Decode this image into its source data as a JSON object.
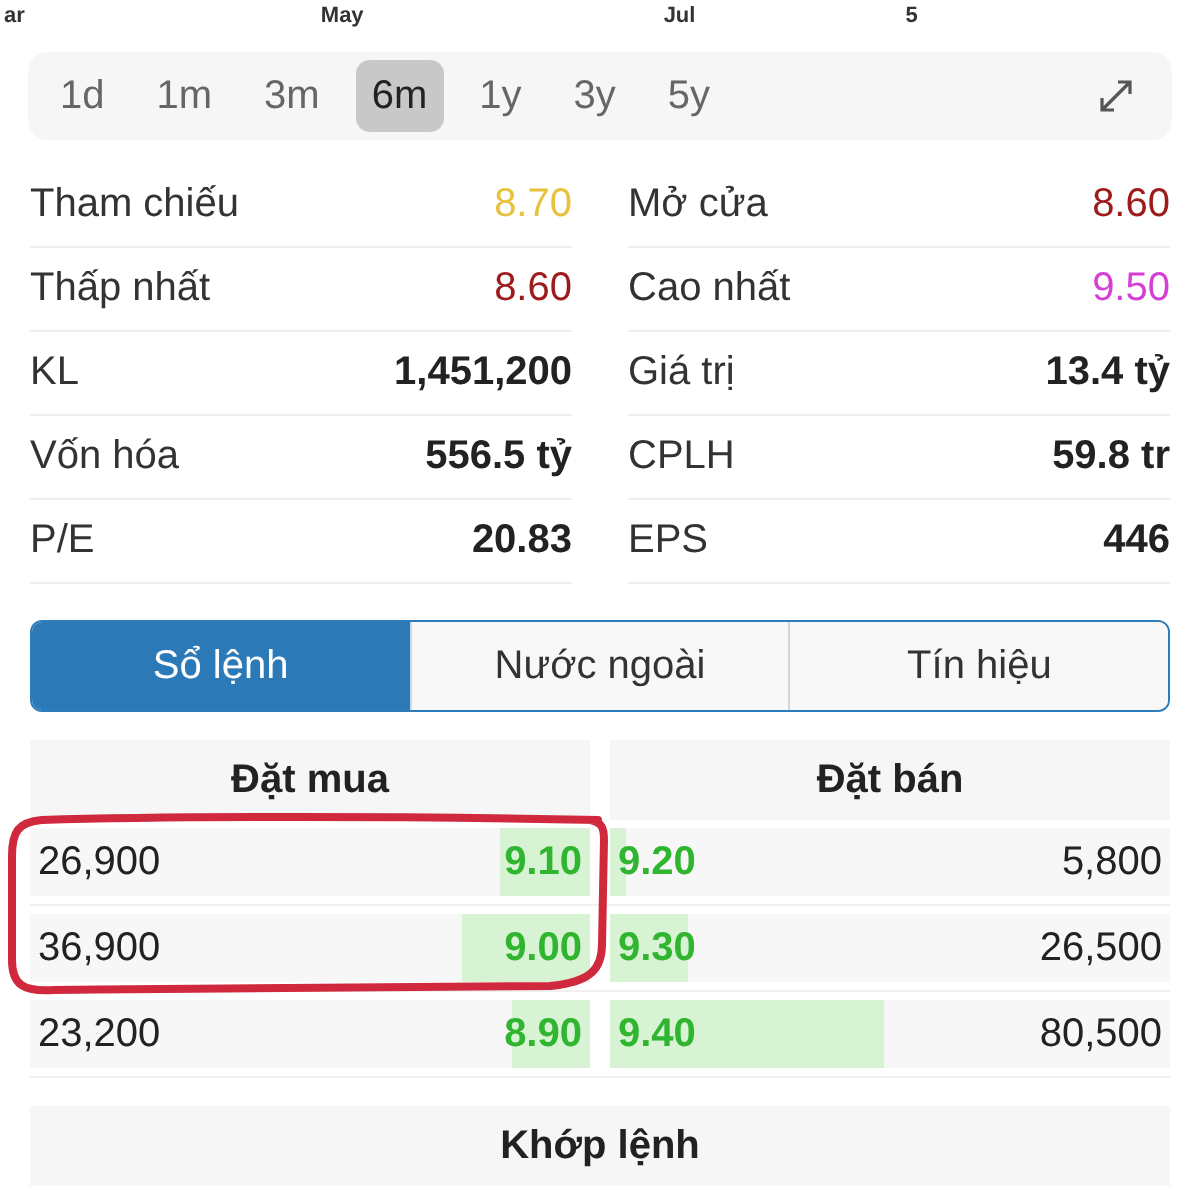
{
  "chart_axis_labels": [
    "ar",
    "May",
    "Jul",
    "5"
  ],
  "ranges": [
    {
      "label": "1d",
      "selected": false
    },
    {
      "label": "1m",
      "selected": false
    },
    {
      "label": "3m",
      "selected": false
    },
    {
      "label": "6m",
      "selected": true
    },
    {
      "label": "1y",
      "selected": false
    },
    {
      "label": "3y",
      "selected": false
    },
    {
      "label": "5y",
      "selected": false
    }
  ],
  "stats": [
    {
      "label": "Tham chiếu",
      "value": "8.70",
      "color": "#e8c23a",
      "bold": false
    },
    {
      "label": "Mở cửa",
      "value": "8.60",
      "color": "#9e1b1b",
      "bold": false
    },
    {
      "label": "Thấp nhất",
      "value": "8.60",
      "color": "#9e1b1b",
      "bold": false
    },
    {
      "label": "Cao nhất",
      "value": "9.50",
      "color": "#d63fd6",
      "bold": false
    },
    {
      "label": "KL",
      "value": "1,451,200",
      "color": "#222222",
      "bold": true
    },
    {
      "label": "Giá trị",
      "value": "13.4 tỷ",
      "color": "#222222",
      "bold": true
    },
    {
      "label": "Vốn hóa",
      "value": "556.5 tỷ",
      "color": "#222222",
      "bold": true
    },
    {
      "label": "CPLH",
      "value": "59.8 tr",
      "color": "#222222",
      "bold": true
    },
    {
      "label": "P/E",
      "value": "20.83",
      "color": "#222222",
      "bold": true
    },
    {
      "label": "EPS",
      "value": "446",
      "color": "#222222",
      "bold": true
    }
  ],
  "tabs": [
    {
      "label": "Sổ lệnh",
      "selected": true
    },
    {
      "label": "Nước ngoài",
      "selected": false
    },
    {
      "label": "Tín hiệu",
      "selected": false
    }
  ],
  "order_book": {
    "buy_header": "Đặt mua",
    "sell_header": "Đặt bán",
    "rows": [
      {
        "buy_volume": "26,900",
        "buy_price": "9.10",
        "buy_depth": {
          "level": 0.16
        },
        "sell_price": "9.20",
        "sell_depth": {
          "level": 0.03
        },
        "sell_volume": "5,800"
      },
      {
        "buy_volume": "36,900",
        "buy_price": "9.00",
        "buy_depth": {
          "level": 0.23
        },
        "sell_price": "9.30",
        "sell_depth": {
          "level": 0.14
        },
        "sell_volume": "26,500"
      },
      {
        "buy_volume": "23,200",
        "buy_price": "8.90",
        "buy_depth": {
          "level": 0.14
        },
        "sell_price": "9.40",
        "sell_depth": {
          "level": 0.49
        },
        "sell_volume": "80,500"
      }
    ]
  },
  "matched_header": "Khớp lệnh"
}
